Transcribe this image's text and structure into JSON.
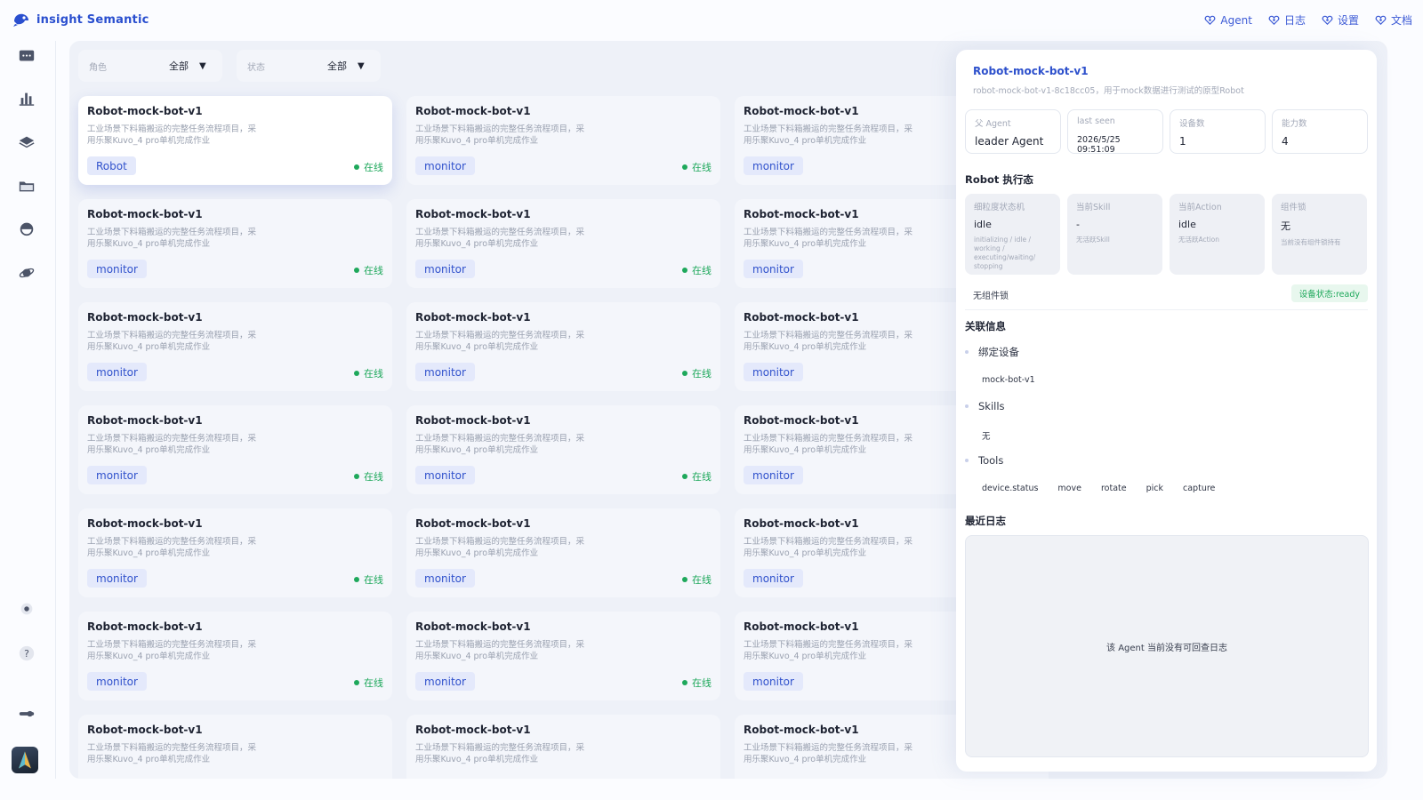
{
  "app": {
    "brand": "insight Semantic"
  },
  "topnav": [
    {
      "label": "Agent",
      "icon": "agent-icon"
    },
    {
      "label": "日志",
      "icon": "log-icon"
    },
    {
      "label": "设置",
      "icon": "settings-icon"
    },
    {
      "label": "文档",
      "icon": "docs-icon"
    }
  ],
  "colors": {
    "brand": "#2a4fcf",
    "online": "#1ea85b",
    "role_bg": "#e4e9fb",
    "panel_bg": "#eef1f8"
  },
  "filters": {
    "role": {
      "label": "角色",
      "value": "全部"
    },
    "status": {
      "label": "状态",
      "value": "全部"
    }
  },
  "cards": [
    {
      "title": "Robot-mock-bot-v1",
      "desc": "工业场景下料箱搬运的完整任务流程项目，采用乐聚Kuvo_4 pro单机完成作业",
      "role": "Robot",
      "status": "在线",
      "selected": true
    },
    {
      "title": "Robot-mock-bot-v1",
      "desc": "工业场景下料箱搬运的完整任务流程项目，采用乐聚Kuvo_4 pro单机完成作业",
      "role": "monitor",
      "status": "在线"
    },
    {
      "title": "Robot-mock-bot-v1",
      "desc": "工业场景下料箱搬运的完整任务流程项目，采用乐聚Kuvo_4 pro单机完成作业",
      "role": "monitor",
      "status": ""
    },
    {
      "title": "Robot-mock-bot-v1",
      "desc": "工业场景下料箱搬运的完整任务流程项目，采用乐聚Kuvo_4 pro单机完成作业",
      "role": "monitor",
      "status": "在线"
    },
    {
      "title": "Robot-mock-bot-v1",
      "desc": "工业场景下料箱搬运的完整任务流程项目，采用乐聚Kuvo_4 pro单机完成作业",
      "role": "monitor",
      "status": "在线"
    },
    {
      "title": "Robot-mock-bot-v1",
      "desc": "工业场景下料箱搬运的完整任务流程项目，采用乐聚Kuvo_4 pro单机完成作业",
      "role": "monitor",
      "status": ""
    },
    {
      "title": "Robot-mock-bot-v1",
      "desc": "工业场景下料箱搬运的完整任务流程项目，采用乐聚Kuvo_4 pro单机完成作业",
      "role": "monitor",
      "status": "在线"
    },
    {
      "title": "Robot-mock-bot-v1",
      "desc": "工业场景下料箱搬运的完整任务流程项目，采用乐聚Kuvo_4 pro单机完成作业",
      "role": "monitor",
      "status": "在线"
    },
    {
      "title": "Robot-mock-bot-v1",
      "desc": "工业场景下料箱搬运的完整任务流程项目，采用乐聚Kuvo_4 pro单机完成作业",
      "role": "monitor",
      "status": ""
    },
    {
      "title": "Robot-mock-bot-v1",
      "desc": "工业场景下料箱搬运的完整任务流程项目，采用乐聚Kuvo_4 pro单机完成作业",
      "role": "monitor",
      "status": "在线"
    },
    {
      "title": "Robot-mock-bot-v1",
      "desc": "工业场景下料箱搬运的完整任务流程项目，采用乐聚Kuvo_4 pro单机完成作业",
      "role": "monitor",
      "status": "在线"
    },
    {
      "title": "Robot-mock-bot-v1",
      "desc": "工业场景下料箱搬运的完整任务流程项目，采用乐聚Kuvo_4 pro单机完成作业",
      "role": "monitor",
      "status": ""
    },
    {
      "title": "Robot-mock-bot-v1",
      "desc": "工业场景下料箱搬运的完整任务流程项目，采用乐聚Kuvo_4 pro单机完成作业",
      "role": "monitor",
      "status": "在线"
    },
    {
      "title": "Robot-mock-bot-v1",
      "desc": "工业场景下料箱搬运的完整任务流程项目，采用乐聚Kuvo_4 pro单机完成作业",
      "role": "monitor",
      "status": "在线"
    },
    {
      "title": "Robot-mock-bot-v1",
      "desc": "工业场景下料箱搬运的完整任务流程项目，采用乐聚Kuvo_4 pro单机完成作业",
      "role": "monitor",
      "status": ""
    },
    {
      "title": "Robot-mock-bot-v1",
      "desc": "工业场景下料箱搬运的完整任务流程项目，采用乐聚Kuvo_4 pro单机完成作业",
      "role": "monitor",
      "status": "在线"
    },
    {
      "title": "Robot-mock-bot-v1",
      "desc": "工业场景下料箱搬运的完整任务流程项目，采用乐聚Kuvo_4 pro单机完成作业",
      "role": "monitor",
      "status": "在线"
    },
    {
      "title": "Robot-mock-bot-v1",
      "desc": "工业场景下料箱搬运的完整任务流程项目，采用乐聚Kuvo_4 pro单机完成作业",
      "role": "monitor",
      "status": ""
    },
    {
      "title": "Robot-mock-bot-v1",
      "desc": "工业场景下料箱搬运的完整任务流程项目，采用乐聚Kuvo_4 pro单机完成作业",
      "role": "",
      "status": ""
    },
    {
      "title": "Robot-mock-bot-v1",
      "desc": "工业场景下料箱搬运的完整任务流程项目，采用乐聚Kuvo_4 pro单机完成作业",
      "role": "",
      "status": ""
    },
    {
      "title": "Robot-mock-bot-v1",
      "desc": "工业场景下料箱搬运的完整任务流程项目，采用乐聚Kuvo_4 pro单机完成作业",
      "role": "",
      "status": ""
    }
  ],
  "detail": {
    "title": "Robot-mock-bot-v1",
    "subtitle": "robot-mock-bot-v1-8c18cc05，用于mock数据进行测试的原型Robot",
    "stats": [
      {
        "label": "父 Agent",
        "value": "leader Agent"
      },
      {
        "label": "last seen",
        "value": "2026/5/25 09:51:09"
      },
      {
        "label": "设备数",
        "value": "1"
      },
      {
        "label": "能力数",
        "value": "4"
      }
    ],
    "exec_title": "Robot 执行态",
    "exec": [
      {
        "label": "细粒度状态机",
        "value": "idle",
        "hint": "initializing / idle / working / executing/waiting/ stopping"
      },
      {
        "label": "当前Skill",
        "value": "-",
        "hint": "无活跃Skill"
      },
      {
        "label": "当前Action",
        "value": "idle",
        "hint": "无活跃Action"
      },
      {
        "label": "组件锁",
        "value": "无",
        "hint": "当前没有组件锁持有"
      }
    ],
    "lock_text": "无组件锁",
    "ready_badge": "设备状态:ready",
    "rel_title": "关联信息",
    "devices_label": "绑定设备",
    "devices": [
      "mock-bot-v1"
    ],
    "skills_label": "Skills",
    "skills": [
      "无"
    ],
    "tools_label": "Tools",
    "tools": [
      "device.status",
      "move",
      "rotate",
      "pick",
      "capture"
    ],
    "logs_title": "最近日志",
    "logs_empty": "该 Agent 当前没有可回查日志"
  }
}
